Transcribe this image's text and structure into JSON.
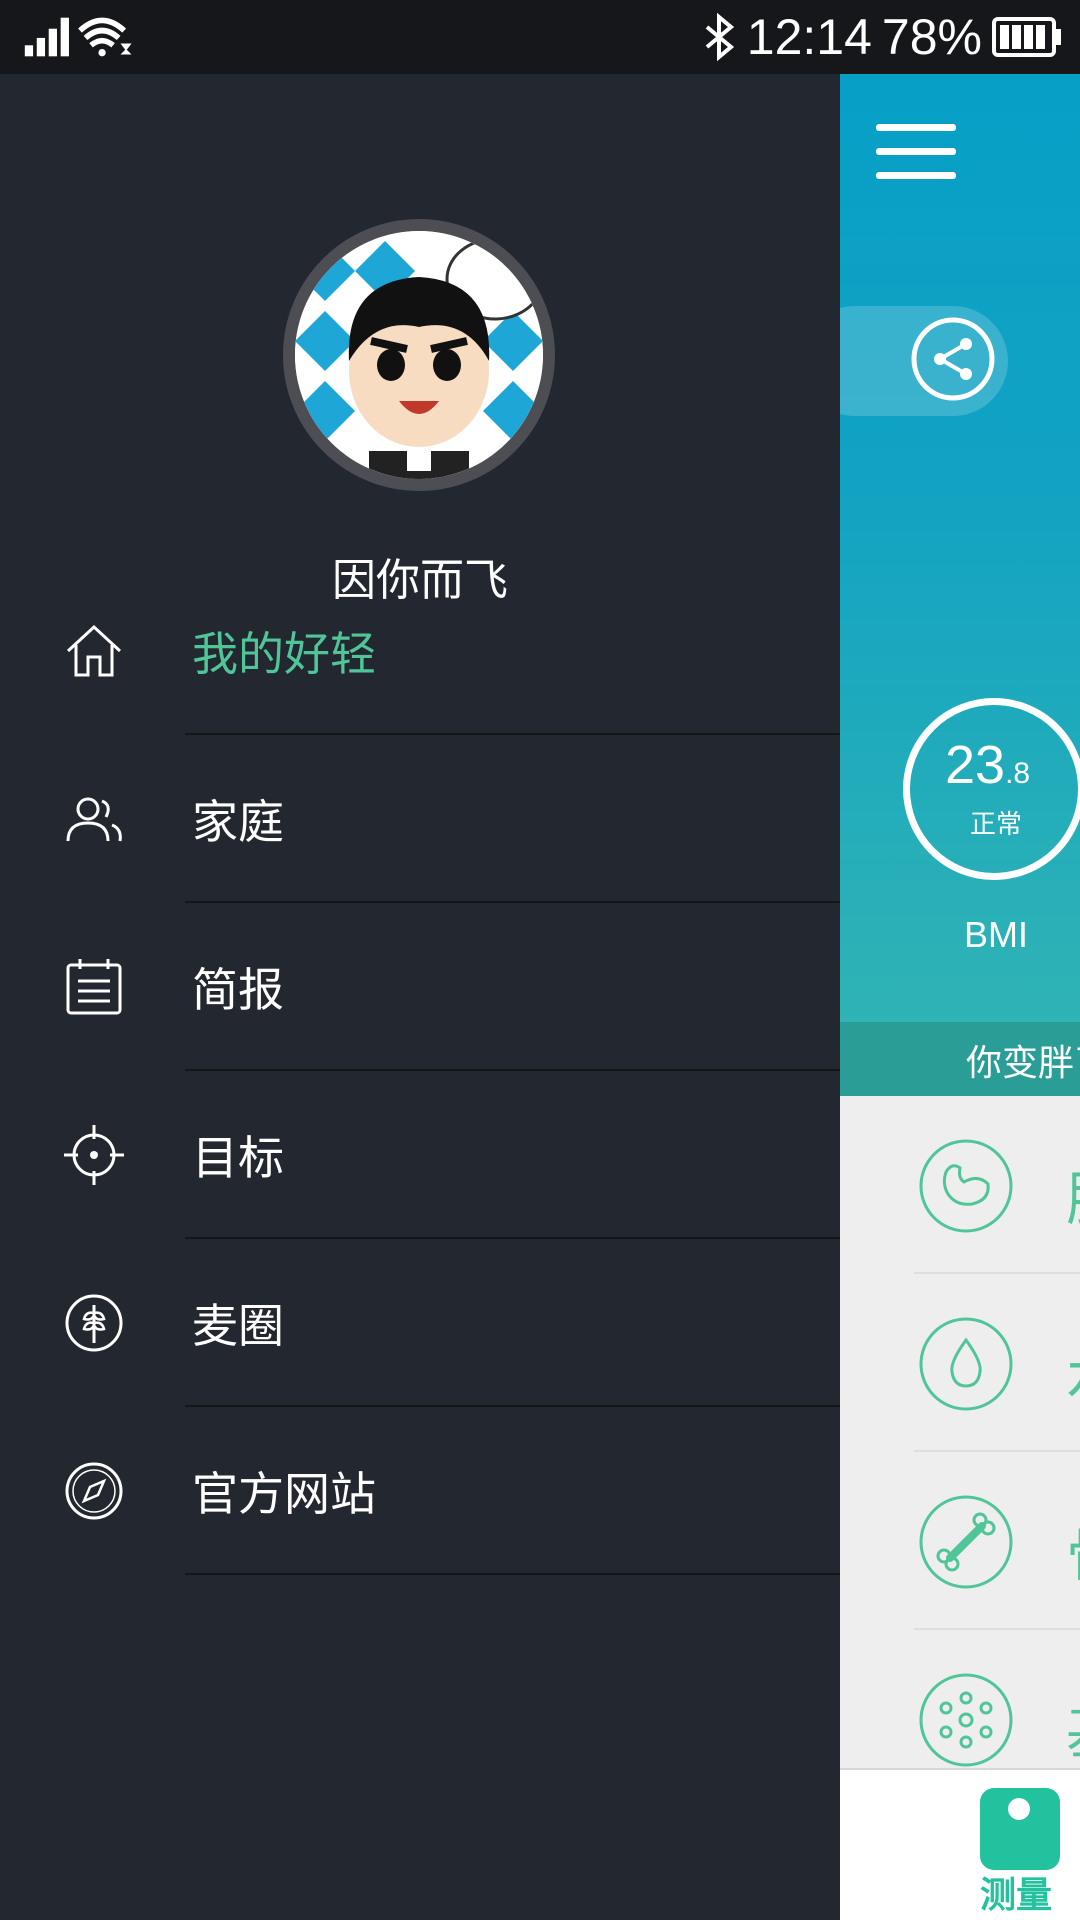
{
  "status_bar": {
    "time": "12:14",
    "battery_percent": "78%",
    "icons": [
      "signal-icon",
      "wifi-icon",
      "bluetooth-icon",
      "battery-icon"
    ]
  },
  "drawer": {
    "avatar_icon": "cartoon-avatar",
    "username": "因你而飞",
    "menu": [
      {
        "label": "我的好轻",
        "icon": "home-icon",
        "active": true
      },
      {
        "label": "家庭",
        "icon": "family-icon",
        "active": false
      },
      {
        "label": "简报",
        "icon": "report-icon",
        "active": false
      },
      {
        "label": "目标",
        "icon": "target-icon",
        "active": false
      },
      {
        "label": "麦圈",
        "icon": "wheat-icon",
        "active": false
      },
      {
        "label": "官方网站",
        "icon": "compass-icon",
        "active": false
      }
    ]
  },
  "main": {
    "bmi_value_int": "23",
    "bmi_value_dec": ".8",
    "bmi_status": "正常",
    "bmi_label": "BMI",
    "banner_text": "你变胖了",
    "metrics": [
      {
        "icon": "muscle-icon",
        "label": "肌"
      },
      {
        "icon": "water-drop-icon",
        "label": "水"
      },
      {
        "icon": "bone-icon",
        "label": "骨"
      },
      {
        "icon": "molecule-icon",
        "label": "基"
      }
    ],
    "measure_label": "测量"
  },
  "colors": {
    "accent_green": "#4fc598",
    "drawer_bg": "#23272f",
    "hero_blue": "#079fc6"
  }
}
